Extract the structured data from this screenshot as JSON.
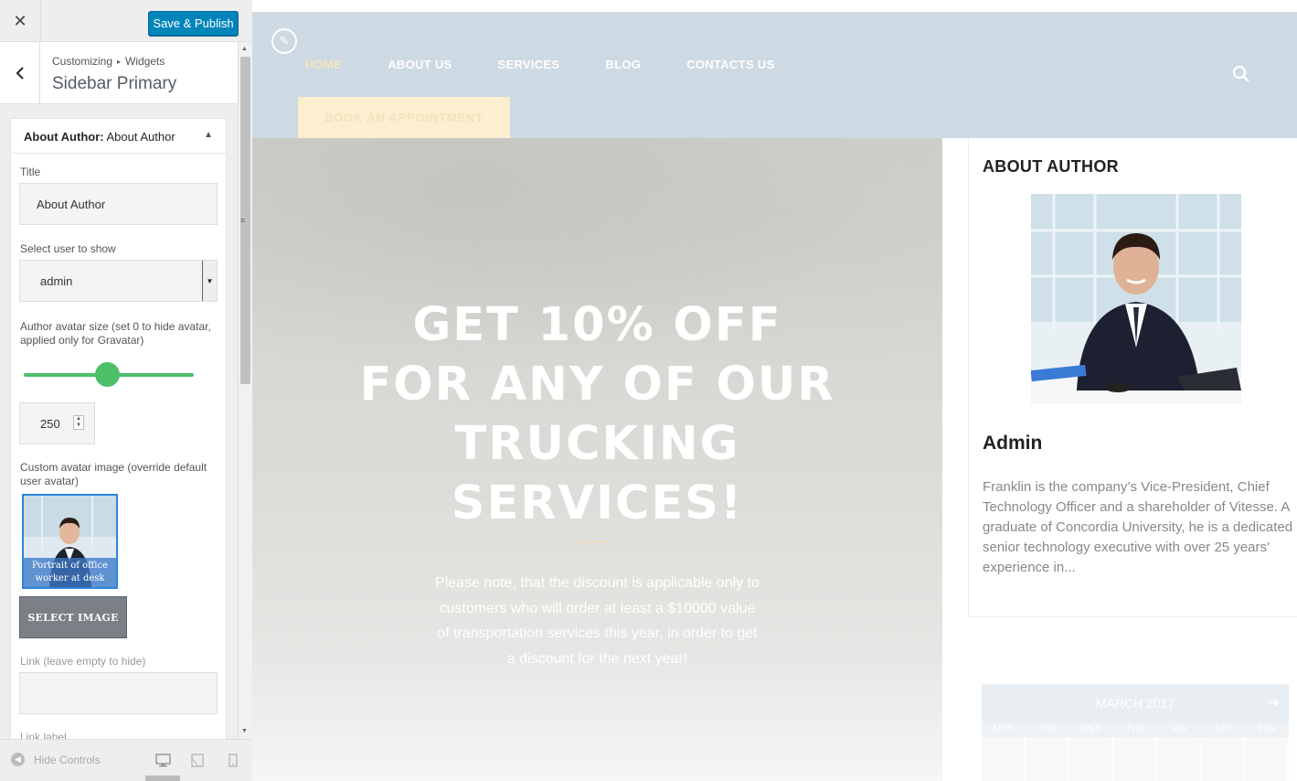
{
  "panel": {
    "close_icon": "close-icon",
    "save_label": "Save & Publish",
    "breadcrumb": {
      "root": "Customizing",
      "sep": "▸",
      "current": "Widgets"
    },
    "section_title": "Sidebar Primary",
    "widget": {
      "header_type": "About Author:",
      "header_name": "About Author",
      "title_label": "Title",
      "title_value": "About Author",
      "user_label": "Select user to show",
      "user_value": "admin",
      "avatar_size_label": "Author avatar size (set 0 to hide avatar, applied only for Gravatar)",
      "avatar_size_slider_fraction": 0.49,
      "avatar_size_value": "250",
      "custom_avatar_label": "Custom avatar image (override default user avatar)",
      "avatar_caption": "Portrait of office worker at desk",
      "select_image_label": "SELECT IMAGE",
      "link_label": "Link (leave empty to hide)",
      "link_value": "",
      "link_label_cut": "Link label"
    },
    "footer": {
      "hide_controls": "Hide Controls",
      "devices": [
        "desktop-icon",
        "tablet-icon",
        "mobile-icon"
      ],
      "active_device": "desktop"
    }
  },
  "preview": {
    "nav": [
      "HOME",
      "ABOUT US",
      "SERVICES",
      "BLOG",
      "CONTACTS US"
    ],
    "active_nav": "HOME",
    "book_button": "BOOK AN APPOINTMENT",
    "hero": {
      "title": "GET 10% OFF FOR ANY OF OUR TRUCKING SERVICES!",
      "text": "Please note, that the discount is applicable only to customers who will order at least a $10000 value of transportation services this year, in order to get a discount for the next year!"
    },
    "sidebar": {
      "heading": "ABOUT AUTHOR",
      "author_name": "Admin",
      "bio": "Franklin is the company’s Vice-President, Chief Technology Officer and a shareholder of Vitesse. A graduate of Concordia University, he is a dedicated senior technology executive with over 25 years’ experience in..."
    },
    "calendar": {
      "month": "MARCH 2017",
      "days": [
        "MON",
        "TUE",
        "WED",
        "THU",
        "FRI",
        "SAT",
        "SUN"
      ]
    }
  },
  "colors": {
    "primary_button": "#0085ba",
    "slider": "#4dbf69",
    "header_bg": "#cdd9e3",
    "nav_active": "#f6e7b7",
    "book_button_bg": "#fbefd0"
  }
}
